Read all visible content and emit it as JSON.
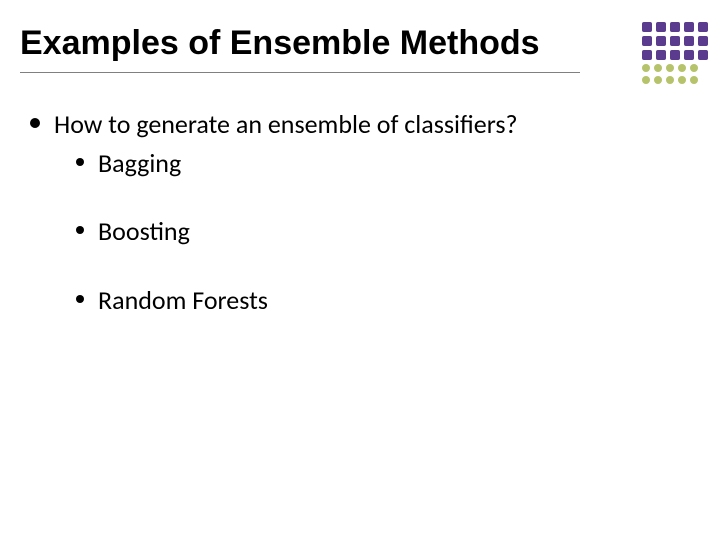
{
  "title": "Examples of Ensemble Methods",
  "body": {
    "l1": "How to generate an ensemble of classifiers?",
    "sub": [
      "Bagging",
      "Boosting",
      "Random Forests"
    ]
  },
  "deco": {
    "colors_row1": [
      "#5a3b8e",
      "#5a3b8e",
      "#5a3b8e",
      "#5a3b8e",
      "#5a3b8e"
    ],
    "colors_row2": [
      "#5a3b8e",
      "#5a3b8e",
      "#5a3b8e",
      "#5a3b8e",
      "#5a3b8e"
    ],
    "colors_row3": [
      "#5a3b8e",
      "#5a3b8e",
      "#5a3b8e",
      "#5a3b8e",
      "#5a3b8e"
    ],
    "colors_row4": [
      "#b6c36b",
      "#b6c36b",
      "#b6c36b",
      "#b6c36b",
      "#b6c36b"
    ],
    "colors_row5": [
      "#b6c36b",
      "#b6c36b",
      "#b6c36b",
      "#b6c36b",
      "#b6c36b"
    ]
  }
}
